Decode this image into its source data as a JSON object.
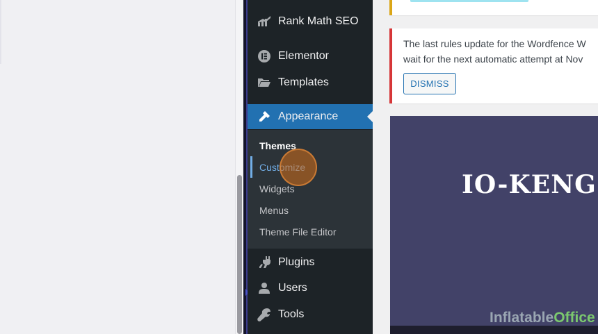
{
  "sidebar": {
    "items": [
      {
        "id": "rank-math",
        "label": "Rank Math SEO",
        "icon": "chart-icon"
      },
      {
        "id": "elementor",
        "label": "Elementor",
        "icon": "elementor-icon"
      },
      {
        "id": "templates",
        "label": "Templates",
        "icon": "folder-icon"
      },
      {
        "id": "appearance",
        "label": "Appearance",
        "icon": "paintbrush-icon",
        "active": true
      },
      {
        "id": "plugins",
        "label": "Plugins",
        "icon": "plug-icon"
      },
      {
        "id": "users",
        "label": "Users",
        "icon": "user-icon"
      },
      {
        "id": "tools",
        "label": "Tools",
        "icon": "wrench-icon"
      }
    ],
    "submenu": [
      {
        "label": "Themes",
        "style": "bold"
      },
      {
        "label": "Customize",
        "style": "current"
      },
      {
        "label": "Widgets"
      },
      {
        "label": "Menus"
      },
      {
        "label": "Theme File Editor"
      }
    ]
  },
  "notices": {
    "error_line1": "The last rules update for the Wordfence W",
    "error_line2": "wait for the next automatic attempt at Nov",
    "dismiss_label": "DISMISS"
  },
  "preview": {
    "title": "IO-KENG",
    "watermark_part1": "Inflatable",
    "watermark_part2": "Office"
  },
  "colors": {
    "sidebar_bg": "#1d2327",
    "active_bg": "#2271b1",
    "submenu_bg": "#2c3338",
    "current_link": "#72aee6",
    "error_border": "#d63638",
    "warning_border": "#dba617",
    "preview_bg": "#424268"
  }
}
